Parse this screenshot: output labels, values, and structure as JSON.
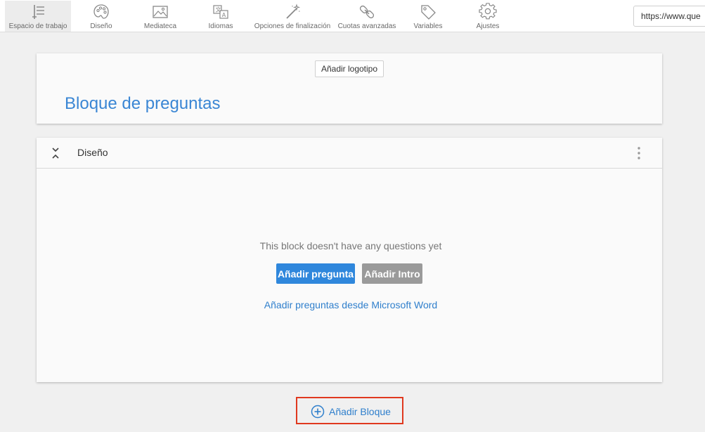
{
  "toolbar": {
    "items": [
      {
        "label": "Espacio de trabajo",
        "icon": "workspace-icon",
        "active": true
      },
      {
        "label": "Diseño",
        "icon": "palette-icon"
      },
      {
        "label": "Mediateca",
        "icon": "image-icon"
      },
      {
        "label": "Idiomas",
        "icon": "translate-icon"
      },
      {
        "label": "Opciones de finalización",
        "icon": "magic-wand-icon"
      },
      {
        "label": "Cuotas avanzadas",
        "icon": "link-chain-icon"
      },
      {
        "label": "Variables",
        "icon": "tag-icon"
      },
      {
        "label": "Ajustes",
        "icon": "gear-icon"
      }
    ],
    "url": "https://www.que"
  },
  "header": {
    "logo_button": "Añadir logotipo",
    "title": "Bloque de preguntas"
  },
  "block": {
    "name": "Diseño",
    "empty_message": "This block doesn't have any questions yet",
    "add_question": "Añadir pregunta",
    "add_intro": "Añadir Intro",
    "word_link": "Añadir preguntas desde Microsoft Word"
  },
  "add_block": {
    "label": "Añadir Bloque"
  },
  "colors": {
    "accent": "#2f87dc",
    "title_blue": "#3a86d4",
    "highlight_frame": "#e0391f",
    "intro_gray": "#9a9a9a"
  }
}
